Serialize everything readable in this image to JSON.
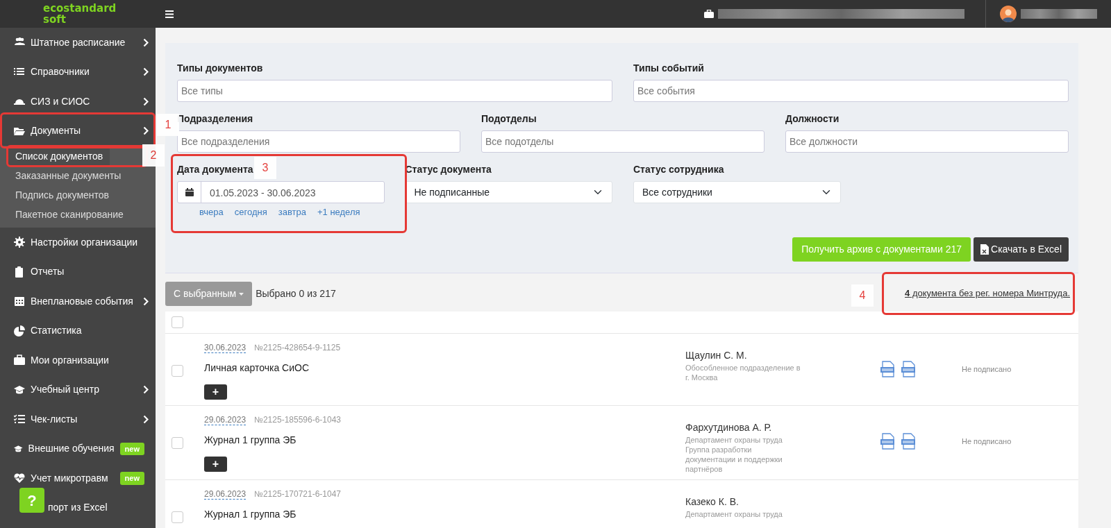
{
  "header": {
    "logo_line1": "ecostandard",
    "logo_line2": "soft"
  },
  "sidebar": {
    "items": [
      {
        "label": "Штатное расписание",
        "has_submenu": true
      },
      {
        "label": "Справочники",
        "has_submenu": true
      },
      {
        "label": "СИЗ и СИОС",
        "has_submenu": true
      },
      {
        "label": "Документы",
        "has_submenu": true,
        "children": [
          {
            "label": "Список документов",
            "selected": true
          },
          {
            "label": "Заказанные документы",
            "selected": false
          },
          {
            "label": "Подпись документов",
            "selected": false
          },
          {
            "label": "Пакетное сканирование",
            "selected": false
          }
        ]
      },
      {
        "label": "Настройки организации",
        "has_submenu": false
      },
      {
        "label": "Отчеты",
        "has_submenu": false
      },
      {
        "label": "Внеплановые события",
        "has_submenu": true
      },
      {
        "label": "Статистика",
        "has_submenu": false
      },
      {
        "label": "Мои организации",
        "has_submenu": false
      },
      {
        "label": "Учебный центр",
        "has_submenu": true
      },
      {
        "label": "Чек-листы",
        "has_submenu": true
      },
      {
        "label": "Внешние обучения",
        "has_submenu": false,
        "badge": "new"
      },
      {
        "label": "Учет микротравм",
        "has_submenu": false,
        "badge": "new"
      },
      {
        "label": "порт из Excel"
      }
    ],
    "help_button": "?"
  },
  "filters": {
    "rows": [
      [
        {
          "label": "Типы документов",
          "kind": "text",
          "placeholder": "Все типы"
        },
        {
          "label": "Типы событий",
          "kind": "text",
          "placeholder": "Все события"
        }
      ],
      [
        {
          "label": "Подразделения",
          "kind": "text",
          "placeholder": "Все подразделения"
        },
        {
          "label": "Подотделы",
          "kind": "text",
          "placeholder": "Все подотделы"
        },
        {
          "label": "Должности",
          "kind": "text",
          "placeholder": "Все должности"
        }
      ],
      [
        {
          "label": "Дата документа",
          "kind": "daterange",
          "value": "01.05.2023 - 30.06.2023",
          "shortcuts": [
            "вчера",
            "сегодня",
            "завтра",
            "+1 неделя"
          ]
        },
        {
          "label": "Статус документа",
          "kind": "select",
          "value": "Не подписанные"
        },
        {
          "label": "Статус сотрудника",
          "kind": "select",
          "value": "Все сотрудники"
        }
      ]
    ],
    "archive_button": "Получить архив с документами 217",
    "excel_button": "Скачать в Excel"
  },
  "toolbar": {
    "bulk_button": "С выбранным",
    "selected_count": "Выбрано 0 из 217",
    "missing_link": "**4** документа без рег. номера Минтруда."
  },
  "table": {
    "header_checked": false,
    "rows": [
      {
        "checked": false,
        "date": "30.06.2023",
        "number": "№2125-428654-9-1125",
        "title": "Личная карточка СиОС",
        "add": "+",
        "person": "Щаулин С. М.",
        "department": [
          "Обособленное подразделение в",
          "г. Москва"
        ],
        "status": "Не подписано"
      },
      {
        "checked": false,
        "date": "29.06.2023",
        "number": "№2125-185596-6-1043",
        "title": "Журнал 1 группа ЭБ",
        "add": "+",
        "person": "Фархутдинова А. Р.",
        "department": [
          "Департамент охраны труда",
          "Группа разработки",
          "документации и поддержки",
          "партнёров"
        ],
        "status": "Не подписано"
      },
      {
        "checked": false,
        "date": "29.06.2023",
        "number": "№2125-170721-6-1047",
        "title": "Журнал 1 группа ЭБ",
        "person": "Казеко К. В.",
        "department": [
          "Департамент охраны труда"
        ]
      }
    ]
  },
  "annotations": [
    {
      "label": "1"
    },
    {
      "label": "2"
    },
    {
      "label": "3"
    },
    {
      "label": "4"
    }
  ]
}
